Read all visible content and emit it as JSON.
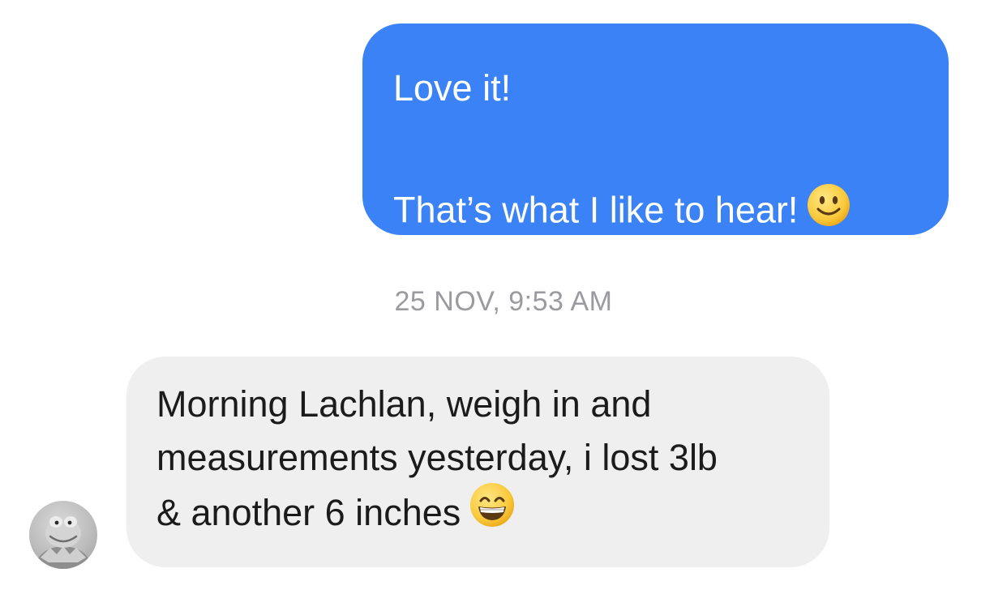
{
  "outgoing_message": {
    "line1": "Love it!",
    "line2": "That’s what I like to hear!",
    "emoji": "slightly-smiling-face-icon",
    "color": "#3a82f6"
  },
  "timestamp": "25 NOV, 9:53 AM",
  "incoming_message": {
    "line1": "Morning Lachlan, weigh in and",
    "line2": "measurements yesterday, i lost 3lb",
    "line3": "& another 6 inches",
    "emoji": "grinning-face-icon",
    "color": "#efeff0"
  },
  "avatar": {
    "icon": "kermit-avatar-icon"
  }
}
